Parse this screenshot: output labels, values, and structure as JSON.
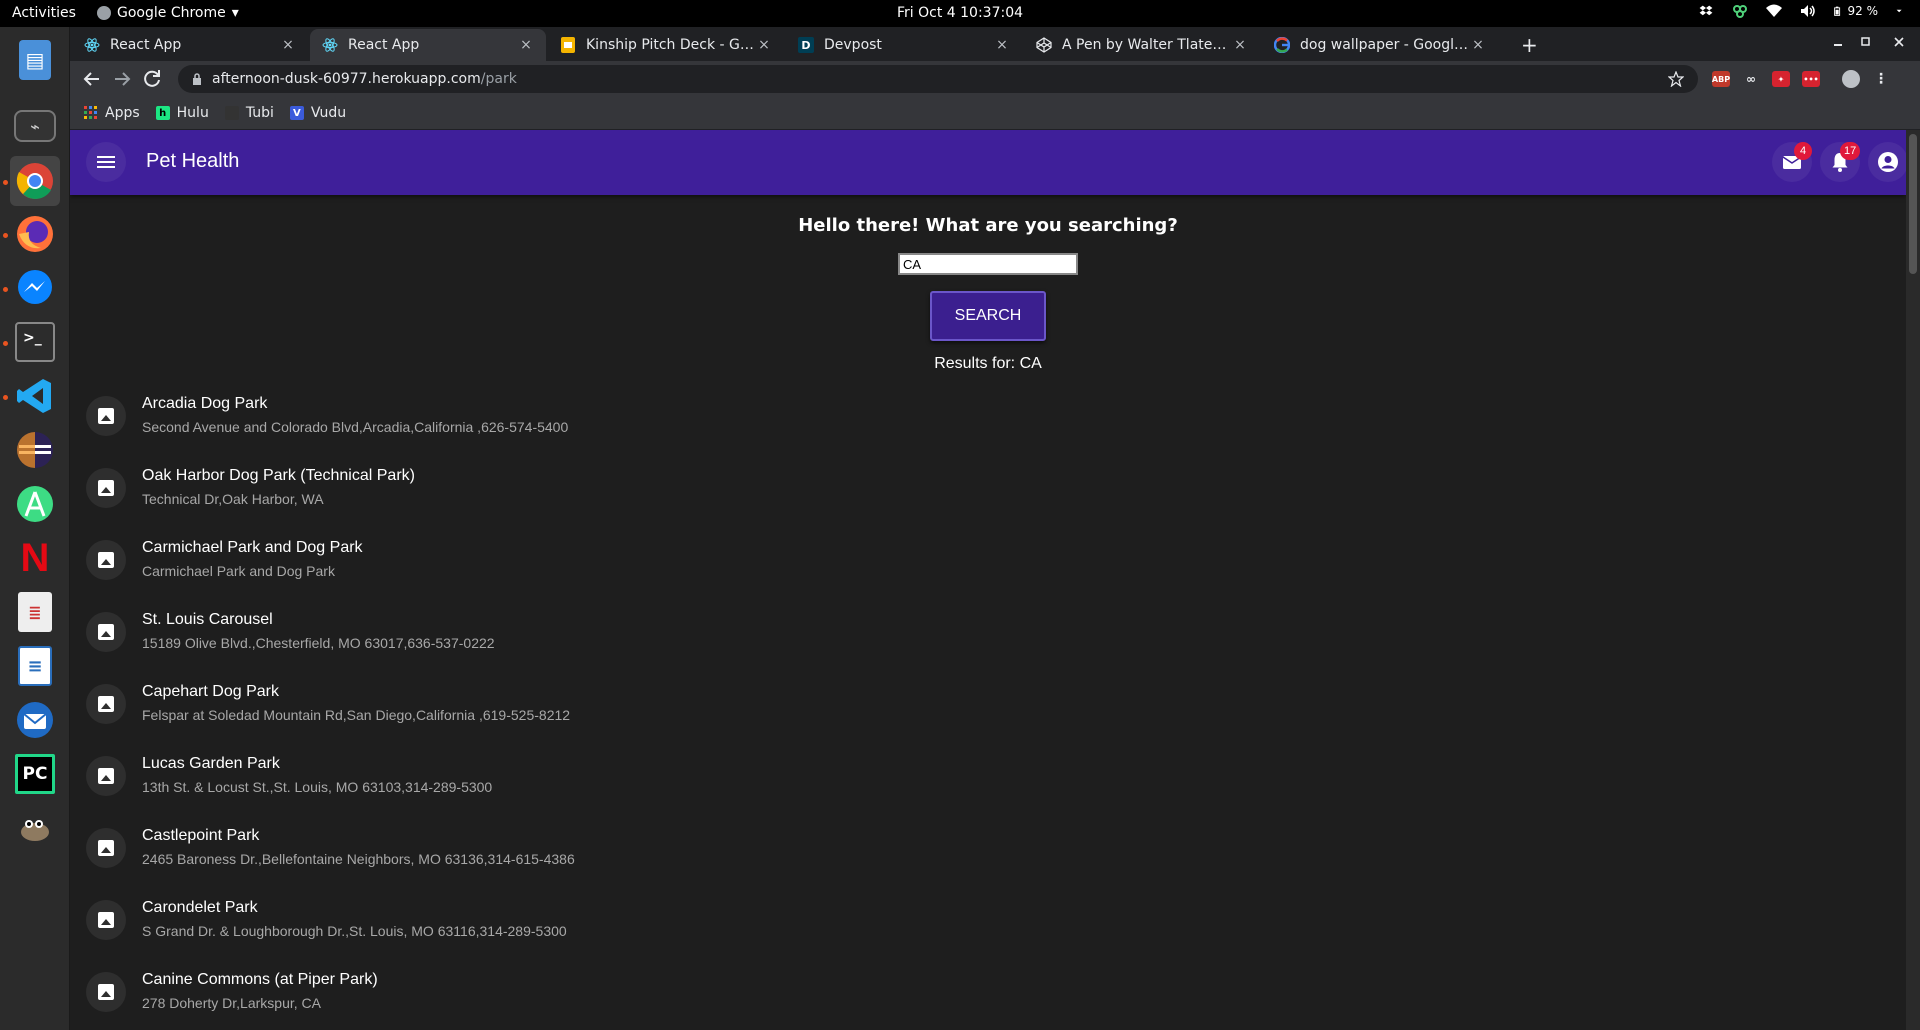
{
  "system": {
    "activities": "Activities",
    "app_name": "Google Chrome",
    "app_caret": "▾",
    "clock": "Fri Oct 4  10:37:04",
    "battery": "92 %"
  },
  "dock": {
    "items": [
      "files",
      "system-monitor",
      "chrome",
      "firefox",
      "messenger",
      "terminal",
      "vscode",
      "eclipse",
      "android-studio",
      "netflix",
      "document-viewer",
      "libreoffice-writer",
      "thunderbird",
      "pycharm",
      "gimp"
    ]
  },
  "browser": {
    "tabs": [
      {
        "title": "React App",
        "favicon": "react-icon"
      },
      {
        "title": "React App",
        "favicon": "react-icon"
      },
      {
        "title": "Kinship Pitch Deck - Goog",
        "favicon": "slides-icon"
      },
      {
        "title": "Devpost",
        "favicon": "devpost-icon"
      },
      {
        "title": "A Pen by Walter Tlatenchi",
        "favicon": "codepen-icon"
      },
      {
        "title": "dog wallpaper - Google Se",
        "favicon": "google-icon"
      }
    ],
    "close_glyph": "×",
    "new_tab_glyph": "+",
    "url_host": "afternoon-dusk-60977.herokuapp.com",
    "url_path": "/park",
    "bookmarks": [
      {
        "label": "Apps",
        "color": "#4285f4"
      },
      {
        "label": "Hulu",
        "color": "#1ce783"
      },
      {
        "label": "Tubi",
        "color": "#333333"
      },
      {
        "label": "Vudu",
        "color": "#3b5bdb"
      }
    ]
  },
  "app": {
    "title": "Pet Health",
    "mail_badge": "4",
    "notif_badge": "17",
    "brand_color": "#3f1f9a",
    "badge_color": "#e0193a",
    "greeting": "Hello there! What are you searching?",
    "search_value": "CA",
    "search_button": "SEARCH",
    "results_label": "Results for: CA",
    "parks": [
      {
        "name": "Arcadia Dog Park",
        "address": "Second Avenue and Colorado Blvd,Arcadia,California ,626-574-5400"
      },
      {
        "name": "Oak Harbor Dog Park (Technical Park)",
        "address": "Technical Dr,Oak Harbor, WA"
      },
      {
        "name": "Carmichael Park and Dog Park",
        "address": "Carmichael Park and Dog Park"
      },
      {
        "name": "St. Louis Carousel",
        "address": "15189 Olive Blvd.,Chesterfield, MO 63017,636-537-0222"
      },
      {
        "name": "Capehart Dog Park",
        "address": "Felspar at Soledad Mountain Rd,San Diego,California ,619-525-8212"
      },
      {
        "name": "Lucas Garden Park",
        "address": "13th St. & Locust St.,St. Louis, MO 63103,314-289-5300"
      },
      {
        "name": "Castlepoint Park",
        "address": "2465 Baroness Dr.,Bellefontaine Neighbors, MO 63136,314-615-4386"
      },
      {
        "name": "Carondelet Park",
        "address": "S Grand Dr. & Loughborough Dr.,St. Louis, MO 63116,314-289-5300"
      },
      {
        "name": "Canine Commons (at Piper Park)",
        "address": "278 Doherty Dr,Larkspur, CA"
      }
    ]
  }
}
